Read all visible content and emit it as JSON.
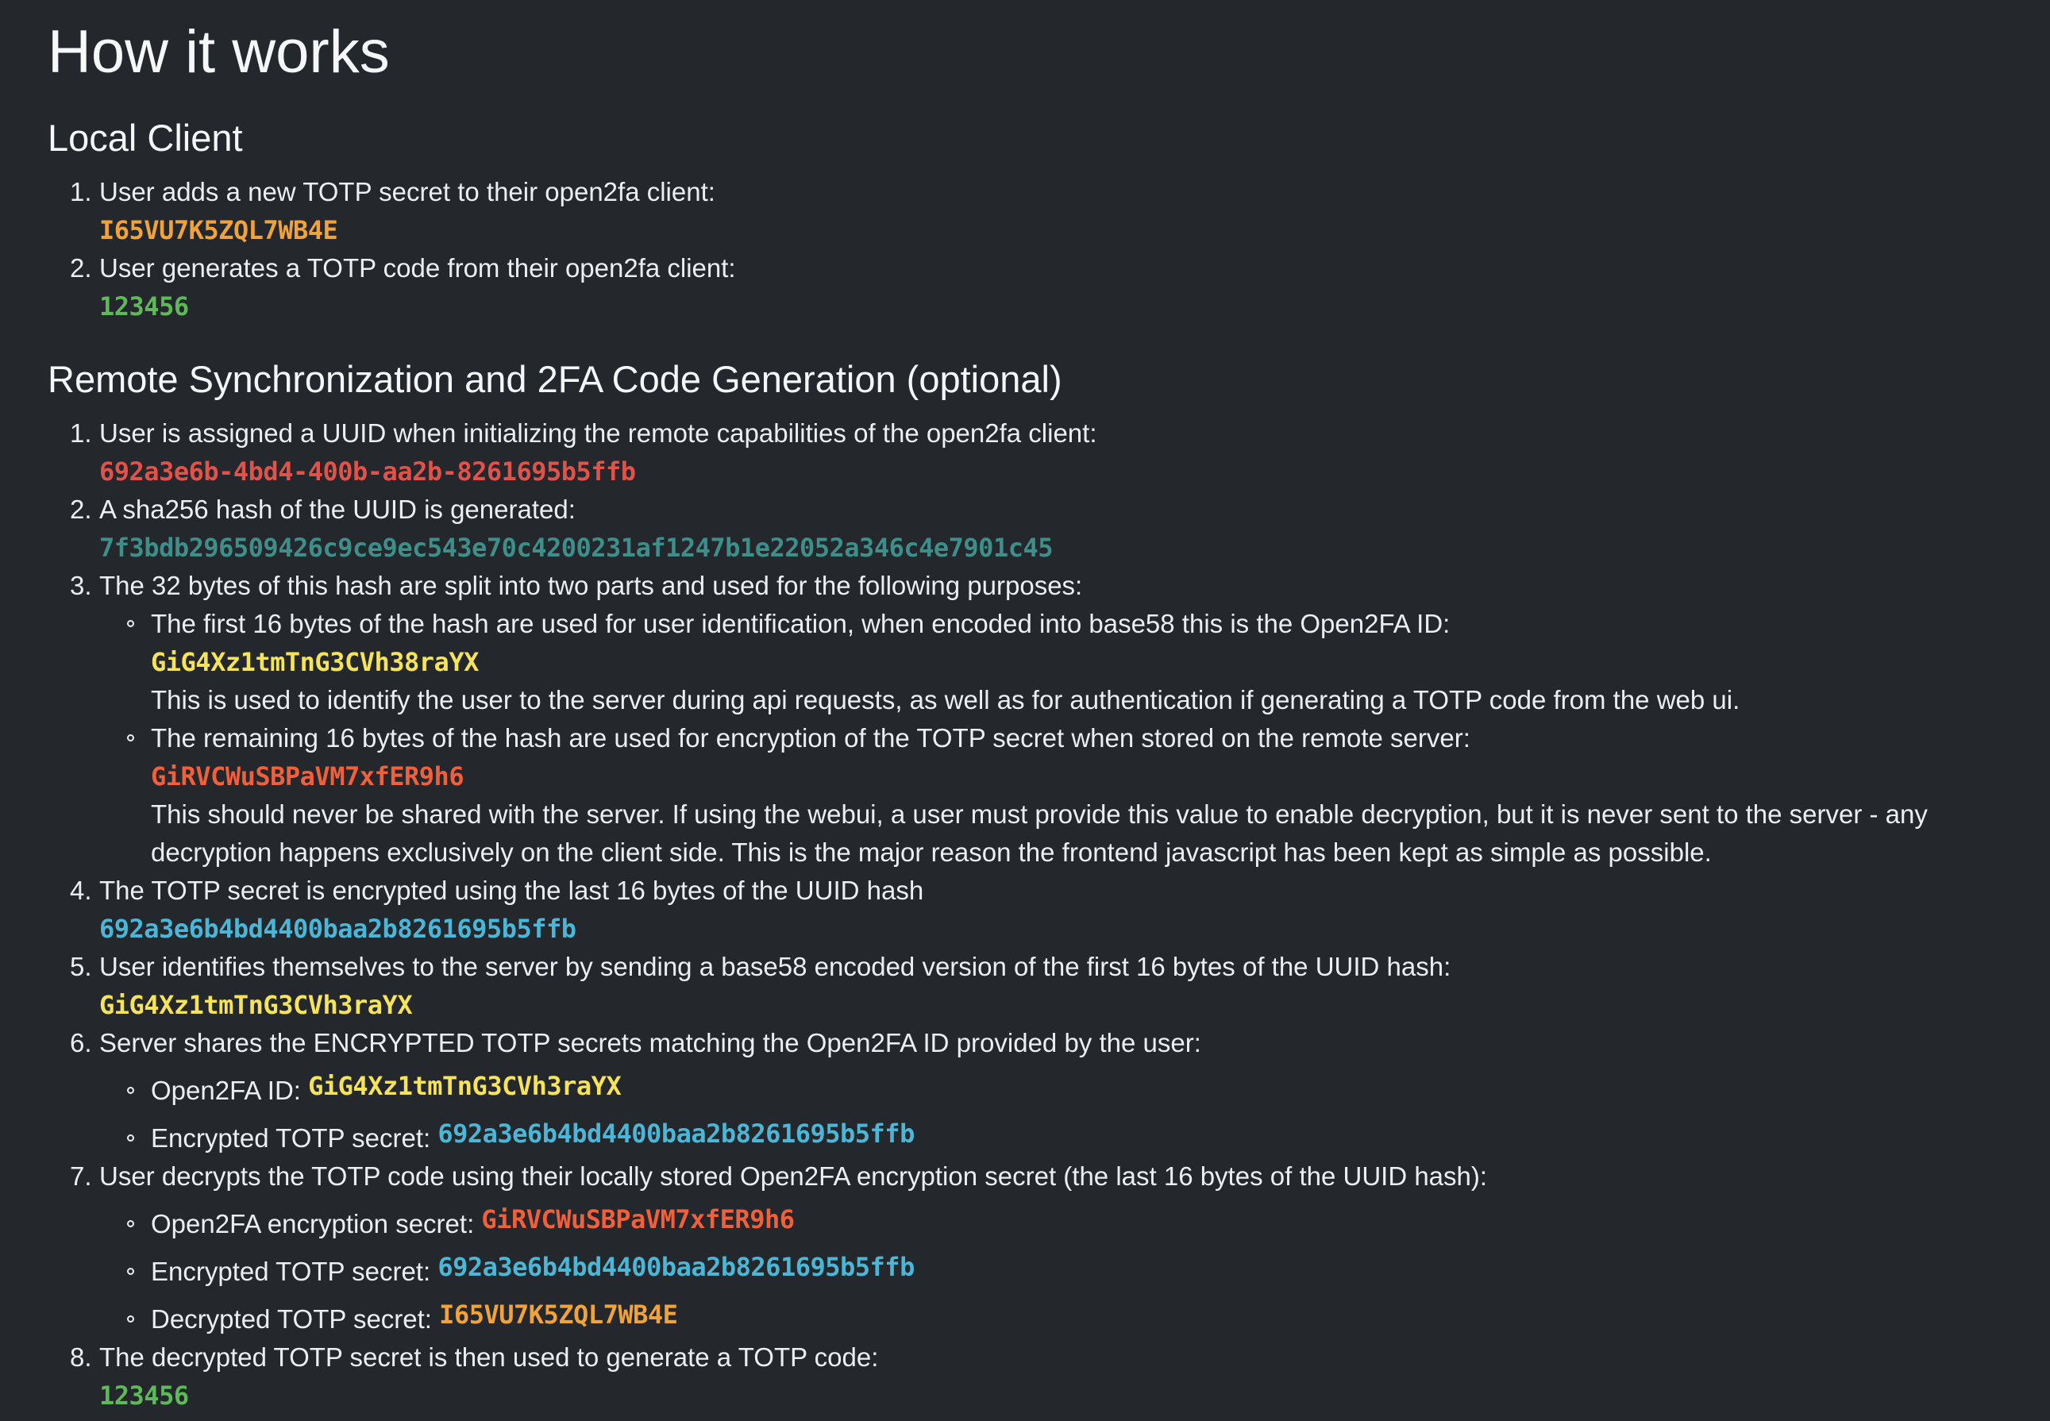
{
  "title": "How it works",
  "local": {
    "heading": "Local Client",
    "steps": [
      {
        "num": "1.",
        "text": "User adds a new TOTP secret to their open2fa client:",
        "code": "I65VU7K5ZQL7WB4E"
      },
      {
        "num": "2.",
        "text": "User generates a TOTP code from their open2fa client:",
        "code": "123456"
      }
    ]
  },
  "remote": {
    "heading": "Remote Synchronization and 2FA Code Generation (optional)",
    "s1": {
      "num": "1.",
      "text": "User is assigned a UUID when initializing the remote capabilities of the open2fa client:",
      "code": "692a3e6b-4bd4-400b-aa2b-8261695b5ffb"
    },
    "s2": {
      "num": "2.",
      "text": "A sha256 hash of the UUID is generated:",
      "code": "7f3bdb296509426c9ce9ec543e70c4200231af1247b1e22052a346c4e7901c45"
    },
    "s3": {
      "num": "3.",
      "text": "The 32 bytes of this hash are split into two parts and used for the following purposes:",
      "sub1": {
        "text": "The first 16 bytes of the hash are used for user identification, when encoded into base58 this is the Open2FA ID:",
        "code": "GiG4Xz1tmTnG3CVh38raYX",
        "note": "This is used to identify the user to the server during api requests, as well as for authentication if generating a TOTP code from the web ui."
      },
      "sub2": {
        "text": "The remaining 16 bytes of the hash are used for encryption of the TOTP secret when stored on the remote server:",
        "code": "GiRVCWuSBPaVM7xfER9h6",
        "note": "This should never be shared with the server. If using the webui, a user must provide this value to enable decryption, but it is never sent to the server - any decryption happens exclusively on the client side. This is the major reason the frontend javascript has been kept as simple as possible."
      }
    },
    "s4": {
      "num": "4.",
      "text": "The TOTP secret is encrypted using the last 16 bytes of the UUID hash",
      "code": "692a3e6b4bd4400baa2b8261695b5ffb"
    },
    "s5": {
      "num": "5.",
      "text": "User identifies themselves to the server by sending a base58 encoded version of the first 16 bytes of the UUID hash:",
      "code": "GiG4Xz1tmTnG3CVh3raYX"
    },
    "s6": {
      "num": "6.",
      "text": "Server shares the ENCRYPTED TOTP secrets matching the Open2FA ID provided by the user:",
      "items": [
        {
          "label": "Open2FA ID:",
          "code": "GiG4Xz1tmTnG3CVh3raYX"
        },
        {
          "label": "Encrypted TOTP secret:",
          "code": "692a3e6b4bd4400baa2b8261695b5ffb"
        }
      ]
    },
    "s7": {
      "num": "7.",
      "text": "User decrypts the TOTP code using their locally stored Open2FA encryption secret (the last 16 bytes of the UUID hash):",
      "items": [
        {
          "label": "Open2FA encryption secret:",
          "code": "GiRVCWuSBPaVM7xfER9h6"
        },
        {
          "label": "Encrypted TOTP secret:",
          "code": "692a3e6b4bd4400baa2b8261695b5ffb"
        },
        {
          "label": "Decrypted TOTP secret:",
          "code": "I65VU7K5ZQL7WB4E"
        }
      ]
    },
    "s8": {
      "num": "8.",
      "text": "The decrypted TOTP secret is then used to generate a TOTP code:",
      "code": "123456"
    }
  },
  "colors": {
    "background": "#24272b",
    "secret": "#f0a33a",
    "totp_code": "#5fb85a",
    "uuid": "#e0524a",
    "hash": "#48a99a",
    "open2fa_id": "#f5e35a",
    "encryption_secret": "#f0603c",
    "encrypted": "#4bb6d6"
  }
}
